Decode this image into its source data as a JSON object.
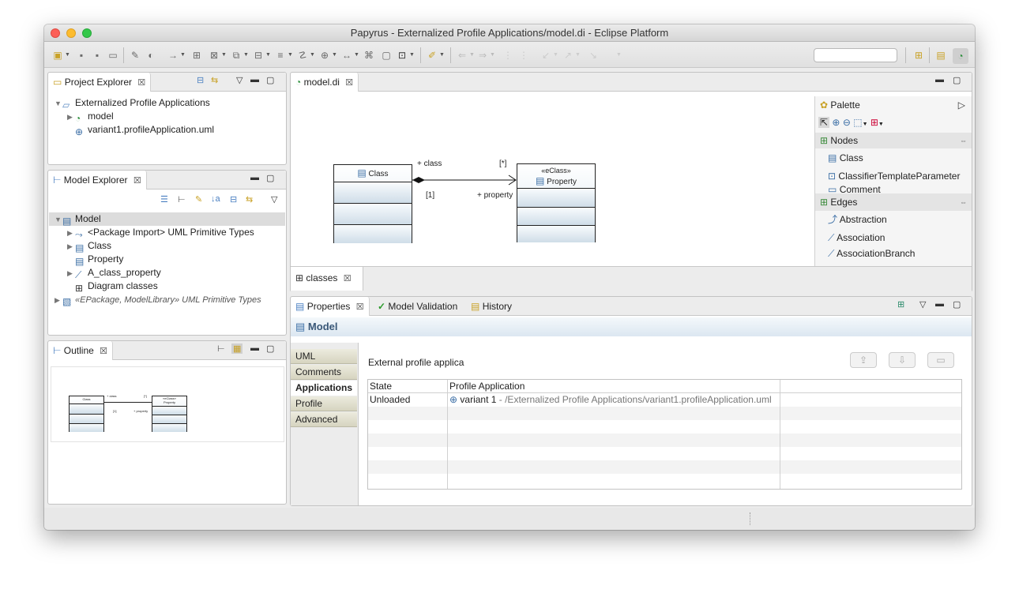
{
  "window": {
    "title": "Papyrus - Externalized Profile Applications/model.di - Eclipse Platform",
    "traffic_colors": {
      "close": "#fc5f57",
      "min": "#fdbc2e",
      "max": "#34c84a"
    }
  },
  "toolbar": {
    "search_placeholder": ""
  },
  "project_explorer": {
    "tab_label": "Project Explorer",
    "items": [
      {
        "label": "Externalized Profile Applications"
      },
      {
        "label": "model"
      },
      {
        "label": "variant1.profileApplication.uml"
      }
    ]
  },
  "model_explorer": {
    "tab_label": "Model Explorer",
    "root": "Model",
    "items": [
      {
        "label": "<Package Import> UML Primitive Types"
      },
      {
        "label": "Class"
      },
      {
        "label": "Property"
      },
      {
        "label": "A_class_property"
      },
      {
        "label": "Diagram classes"
      }
    ],
    "extra": "«EPackage, ModelLibrary» UML Primitive Types"
  },
  "outline": {
    "tab_label": "Outline",
    "mini_class": "Class",
    "mini_property": "Property",
    "mini_stereo": "«eClass»",
    "mini_assoc_end": "+ class",
    "mini_mult_many": "[*]",
    "mini_mult_one": "[1]",
    "mini_prop_end": "+ property"
  },
  "editor": {
    "tab_label": "model.di",
    "diagram_tab": "classes",
    "class_name": "Class",
    "property_name": "Property",
    "property_stereotype": "«eClass»",
    "assoc_end_class": "+ class",
    "assoc_mult_many": "[*]",
    "assoc_mult_one": "[1]",
    "assoc_end_property": "+ property"
  },
  "palette": {
    "title": "Palette",
    "nodes_label": "Nodes",
    "nodes": [
      "Class",
      "ClassifierTemplateParameter",
      "Comment"
    ],
    "edges_label": "Edges",
    "edges": [
      "Abstraction",
      "Association",
      "AssociationBranch"
    ]
  },
  "properties": {
    "tabs": [
      "Properties",
      "Model Validation",
      "History"
    ],
    "header": "Model",
    "side_tabs": [
      "UML",
      "Comments",
      "Applications",
      "Profile",
      "Advanced"
    ],
    "selected_side_tab": "Applications",
    "section_label": "External profile applica",
    "columns": [
      "State",
      "Profile Application"
    ],
    "rows": [
      {
        "state": "Unloaded",
        "name": "variant 1",
        "path": " - /Externalized Profile Applications/variant1.profileApplication.uml"
      }
    ]
  }
}
